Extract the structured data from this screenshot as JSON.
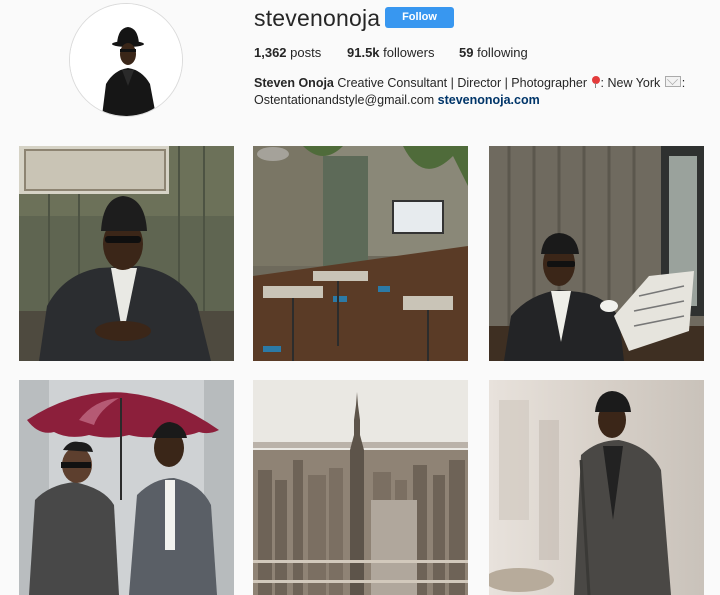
{
  "profile": {
    "username": "stevenonoja",
    "follow_label": "Follow",
    "stats": {
      "posts_count": "1,362",
      "posts_label": "posts",
      "followers_count": "91.5k",
      "followers_label": "followers",
      "following_count": "59",
      "following_label": "following"
    },
    "bio": {
      "name": "Steven Onoja",
      "line1_text": "Creative Consultant | Director | Photographer",
      "location": ": New York",
      "email": "Ostentationandstyle@gmail.com",
      "website": "stevenonoja.com",
      "pin_icon": "round-pushpin-icon",
      "mail_icon": "envelope-icon"
    }
  },
  "posts": [
    {
      "id": "post-1"
    },
    {
      "id": "post-2"
    },
    {
      "id": "post-3"
    },
    {
      "id": "post-4"
    },
    {
      "id": "post-5"
    },
    {
      "id": "post-6"
    }
  ],
  "colors": {
    "follow_button": "#3897f0",
    "link": "#003569",
    "background": "#fafafa"
  }
}
